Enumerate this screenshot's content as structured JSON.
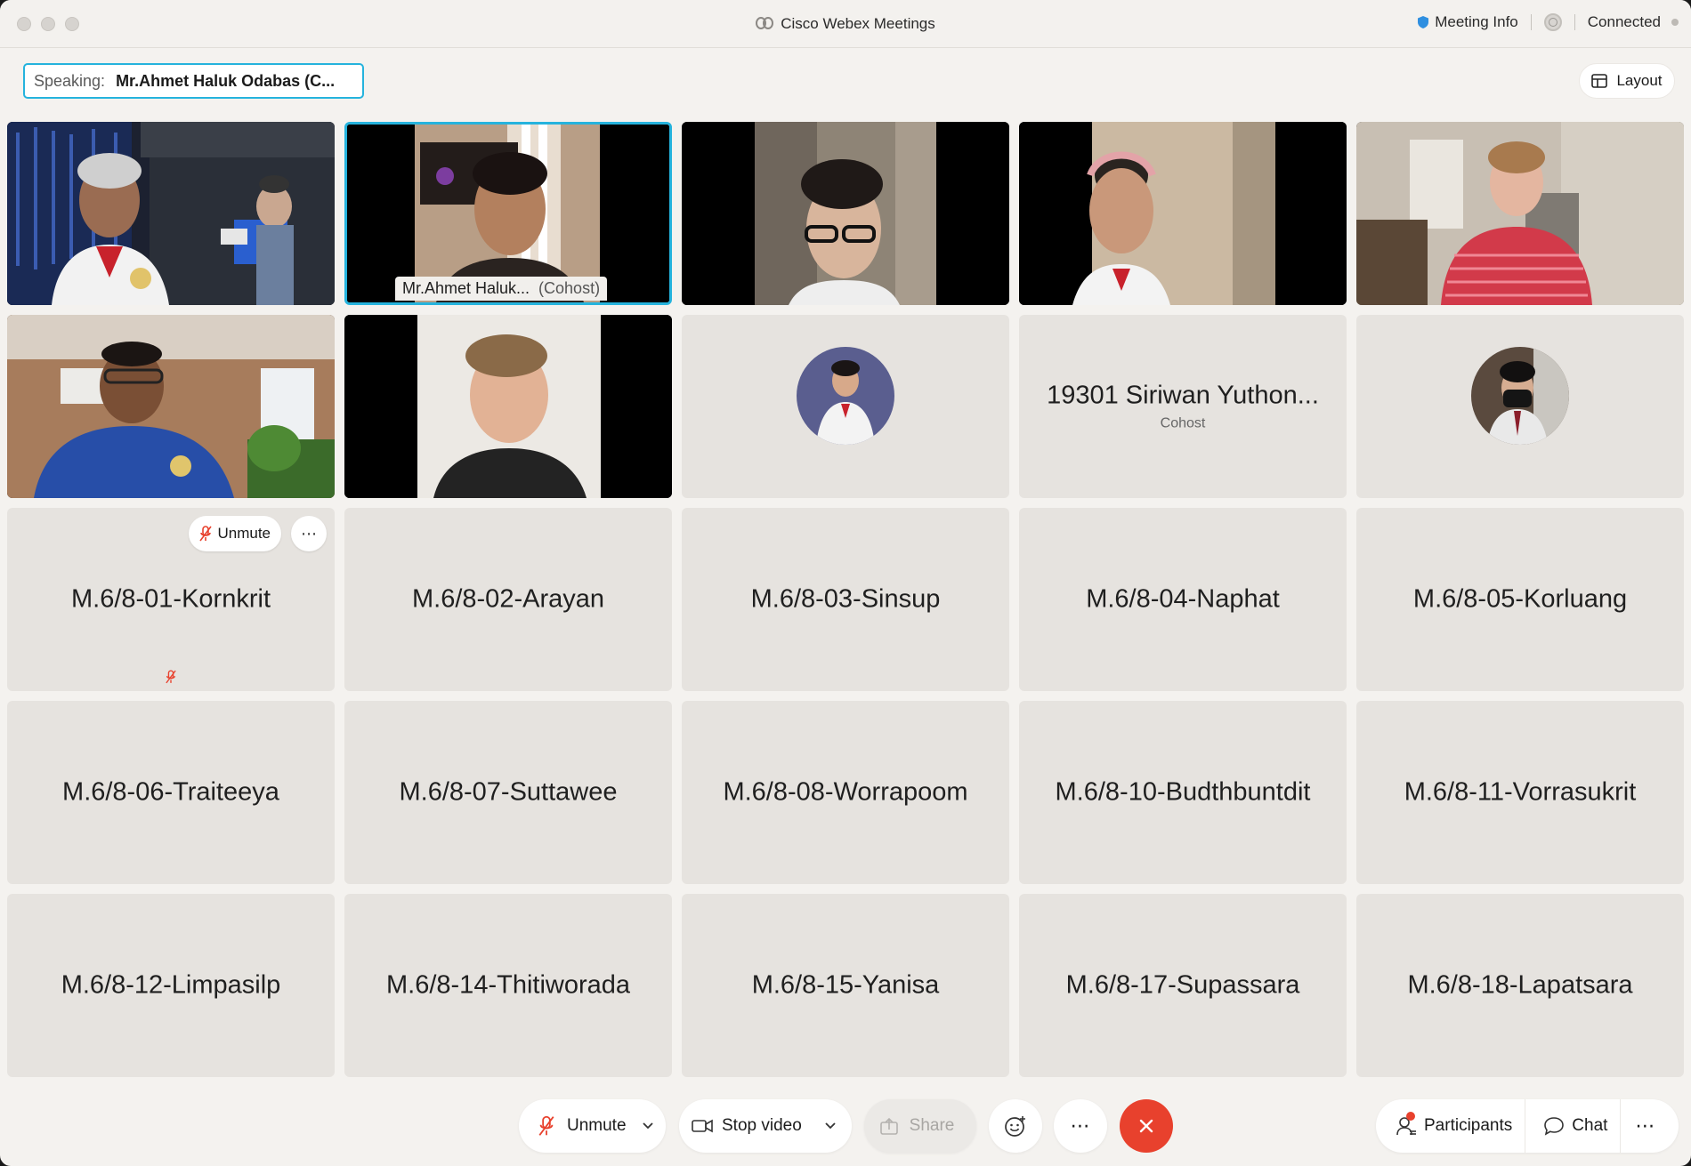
{
  "window": {
    "title": "Cisco Webex Meetings",
    "meeting_info_label": "Meeting Info",
    "connection_status": "Connected"
  },
  "header": {
    "speaking_label": "Speaking:",
    "speaking_name": "Mr.Ahmet Haluk Odabas (C...",
    "layout_label": "Layout"
  },
  "tiles": [
    {
      "kind": "video"
    },
    {
      "kind": "video",
      "active": true,
      "name": "Mr.Ahmet Haluk...",
      "role": "(Cohost)"
    },
    {
      "kind": "video"
    },
    {
      "kind": "video"
    },
    {
      "kind": "video"
    },
    {
      "kind": "video"
    },
    {
      "kind": "video"
    },
    {
      "kind": "avatar"
    },
    {
      "kind": "name",
      "name": "19301 Siriwan Yuthon...",
      "role": "Cohost"
    },
    {
      "kind": "avatar"
    },
    {
      "kind": "name",
      "name": "M.6/8-01-Kornkrit",
      "hover_unmute": "Unmute",
      "muted": true
    },
    {
      "kind": "name",
      "name": "M.6/8-02-Arayan"
    },
    {
      "kind": "name",
      "name": "M.6/8-03-Sinsup"
    },
    {
      "kind": "name",
      "name": "M.6/8-04-Naphat"
    },
    {
      "kind": "name",
      "name": "M.6/8-05-Korluang"
    },
    {
      "kind": "name",
      "name": "M.6/8-06-Traiteeya"
    },
    {
      "kind": "name",
      "name": "M.6/8-07-Suttawee"
    },
    {
      "kind": "name",
      "name": "M.6/8-08-Worrapoom"
    },
    {
      "kind": "name",
      "name": "M.6/8-10-Budthbuntdit"
    },
    {
      "kind": "name",
      "name": "M.6/8-11-Vorrasukrit"
    },
    {
      "kind": "name",
      "name": "M.6/8-12-Limpasilp"
    },
    {
      "kind": "name",
      "name": "M.6/8-14-Thitiworada"
    },
    {
      "kind": "name",
      "name": "M.6/8-15-Yanisa"
    },
    {
      "kind": "name",
      "name": "M.6/8-17-Supassara"
    },
    {
      "kind": "name",
      "name": "M.6/8-18-Lapatsara"
    }
  ],
  "controls": {
    "unmute_label": "Unmute",
    "stop_video_label": "Stop video",
    "share_label": "Share",
    "participants_label": "Participants",
    "chat_label": "Chat"
  },
  "colors": {
    "accent": "#25b3dd",
    "end_call": "#e8412d",
    "muted_red": "#e8412d",
    "tile_bg": "#e6e3df",
    "window_bg": "#f4f2ef"
  }
}
